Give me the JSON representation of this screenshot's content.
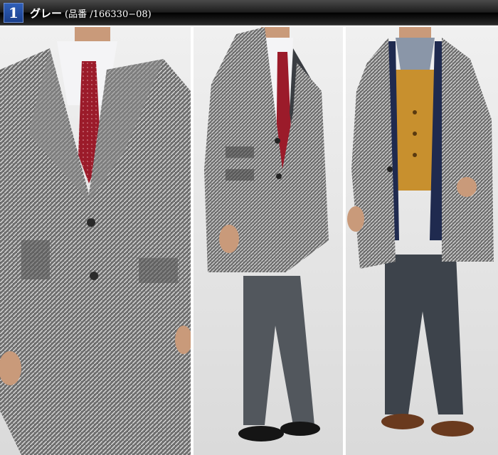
{
  "header": {
    "number": "1",
    "color_name": "グレー",
    "product_code": "(品番 /166330−08)"
  },
  "panels": [
    {
      "name": "closeup-front"
    },
    {
      "name": "side-view"
    },
    {
      "name": "front-open"
    }
  ],
  "colors": {
    "coat": "#7a7a7a",
    "trousers": "#555a60",
    "tie": "#9b1b2a",
    "vest": "#c8902e",
    "scarf": "#1f2a4f",
    "shoes": "#6a3a1e"
  }
}
